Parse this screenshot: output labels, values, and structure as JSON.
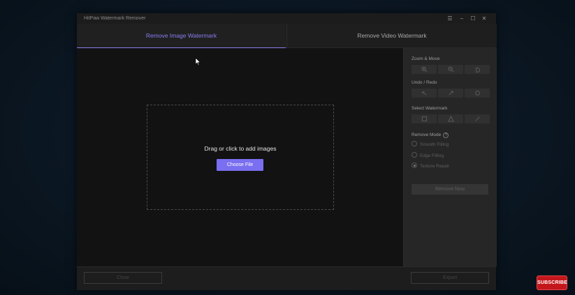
{
  "window": {
    "title": "HitPaw Watermark Remover"
  },
  "window_controls": {
    "menu": "☰",
    "minimize": "–",
    "maximize": "☐",
    "close": "✕"
  },
  "tabs": [
    {
      "label": "Remove Image Watermark",
      "active": true
    },
    {
      "label": "Remove Video Watermark",
      "active": false
    }
  ],
  "canvas": {
    "drop_text": "Drag or click to add images",
    "choose_button": "Choose File"
  },
  "panel": {
    "zoom_move": {
      "title": "Zoom & Move",
      "icons": [
        "zoom-in-icon",
        "zoom-out-icon",
        "hand-icon"
      ]
    },
    "undo_redo": {
      "title": "Undo / Redo",
      "icons": [
        "undo-icon",
        "redo-icon",
        "reset-icon"
      ]
    },
    "select_watermark": {
      "title": "Select Watermark",
      "icons": [
        "rectangle-select-icon",
        "polygon-select-icon",
        "brush-icon"
      ]
    },
    "remove_mode": {
      "title": "Remove Mode",
      "options": [
        {
          "label": "Smooth Filling",
          "checked": false
        },
        {
          "label": "Edge Filling",
          "checked": false
        },
        {
          "label": "Texture Repair",
          "checked": true
        }
      ]
    },
    "remove_now": "Remove Now"
  },
  "bottom": {
    "close_label": "Close",
    "export_label": "Export"
  },
  "overlay": {
    "subscribe_label": "SUBSCRIBE"
  },
  "colors": {
    "accent": "#7a6ff0",
    "subscribe": "#c4171c"
  }
}
